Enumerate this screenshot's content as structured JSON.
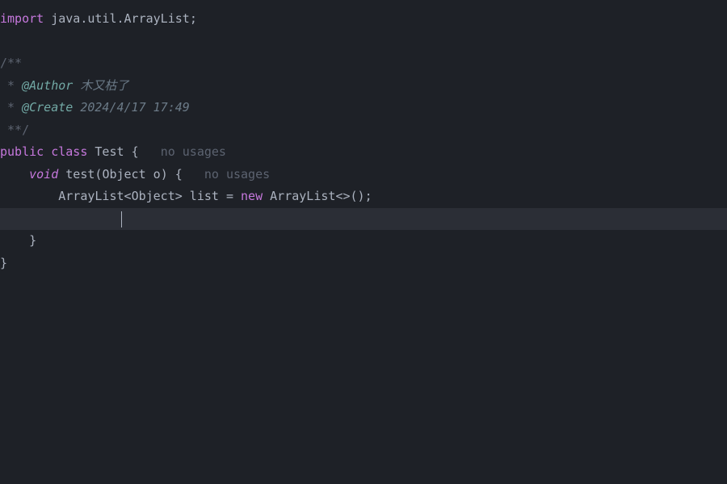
{
  "code": {
    "import_kw": "import",
    "import_pkg": " java.util.ArrayList",
    "semi": ";",
    "doc_open": "/**",
    "doc_star": " * ",
    "author_tag": "@Author",
    "author_val": " 木又枯了",
    "create_tag": "@Create",
    "create_val": " 2024/4/17 17:49",
    "doc_close": " **/",
    "public_kw": "public",
    "class_kw": " class",
    "class_name": " Test ",
    "open_brace": "{",
    "usages_hint": "no usages",
    "indent1": "    ",
    "void_kw": "void",
    "method_name": " test",
    "method_params_open": "(",
    "param_type": "Object",
    "param_name": " o",
    "method_params_close": ") ",
    "indent2": "        ",
    "arraylist_type": "ArrayList",
    "generic_open": "<",
    "generic_type": "Object",
    "generic_close": ">",
    "var_name": " list ",
    "assign": "= ",
    "new_kw": "new",
    "ctor_name": " ArrayList",
    "diamond": "<>",
    "call_parens": "()",
    "close_brace1": "    }",
    "close_brace2": "}"
  },
  "colors": {
    "background": "#1e2127",
    "highlight": "#2b2e36"
  }
}
